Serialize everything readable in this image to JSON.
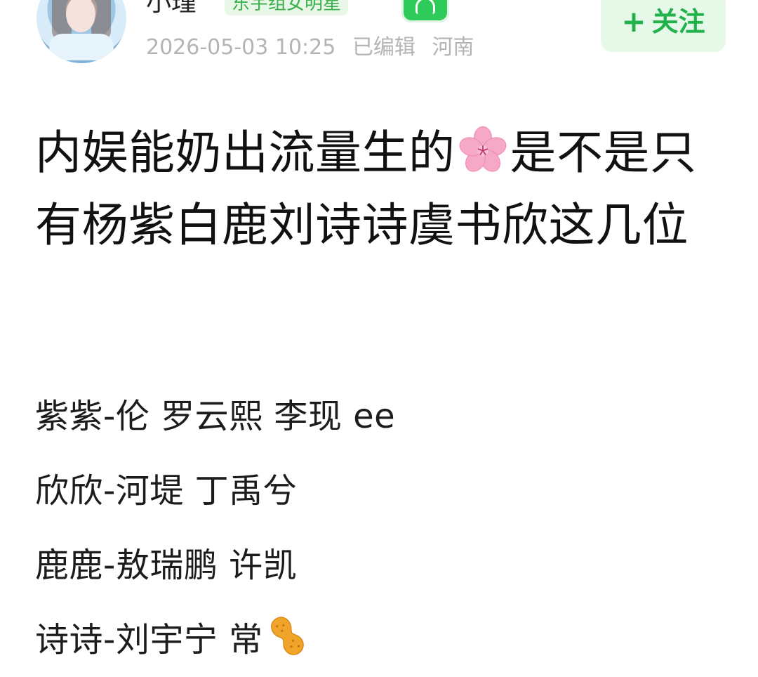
{
  "header": {
    "username": "小瑾",
    "badge": "东宇组女明星",
    "timestamp": "2026-05-03 10:25",
    "edited": "已编辑",
    "location": "河南",
    "follow_label": "关注",
    "follow_icon": "plus-icon",
    "phone_badge_icon": "headset-phone-icon"
  },
  "post": {
    "title_part1": "内娱能奶出流量生的",
    "title_emoji": "sakura-icon",
    "title_part2": "是不是只有杨紫白鹿刘诗诗虞书欣这几位",
    "lines": [
      "紫紫-伦 罗云熙 李现 ee",
      "欣欣-河堤 丁禹兮",
      "鹿鹿-敖瑞鹏 许凯",
      "诗诗-刘宇宁 常"
    ],
    "line4_emoji": "peanut-icon"
  },
  "colors": {
    "accent_green": "#22b24c",
    "badge_green": "#3ab04a",
    "meta_gray": "#b4b4b4"
  }
}
